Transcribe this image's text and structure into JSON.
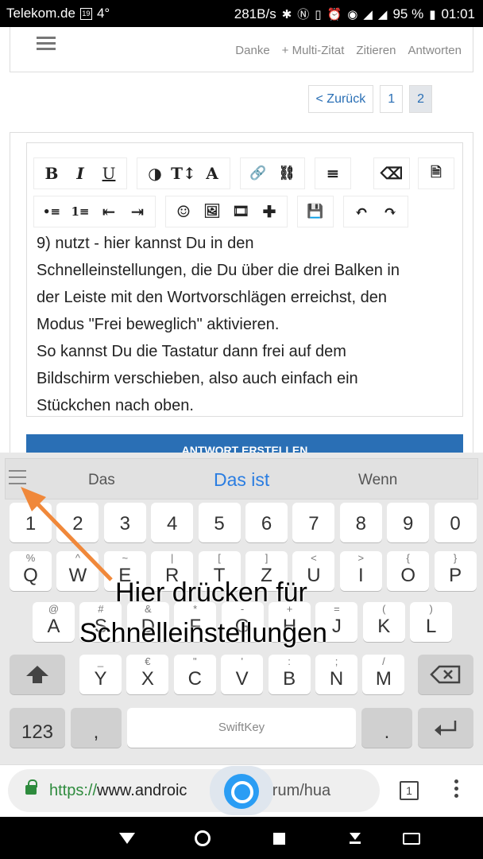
{
  "status": {
    "carrier": "Telekom.de",
    "calendar_day": "19",
    "temp": "4°",
    "speed": "281B/s",
    "battery": "95 %",
    "time": "01:01"
  },
  "post_actions": [
    "Danke",
    "+ Multi-Zitat",
    "Zitieren",
    "Antworten"
  ],
  "pager": {
    "back": "< Zurück",
    "pages": [
      "1",
      "2"
    ],
    "active": "2"
  },
  "editor": {
    "toolbar_row1": [
      [
        "B",
        "I",
        "U"
      ],
      [
        "◑",
        "T↕",
        "A"
      ],
      [
        "🔗",
        "⛓"
      ],
      [
        "≡"
      ]
    ],
    "toolbar_row1_right": [
      "⌫",
      "🗎"
    ],
    "toolbar_row2": [
      [
        "•≡",
        "1≡",
        "⇤",
        "⇥"
      ],
      [
        "☺",
        "🖼",
        "🎞",
        "✚"
      ],
      [
        "💾"
      ],
      [
        "↶",
        "↷"
      ]
    ],
    "text_lines": [
      "9) nutzt - hier kannst Du in den",
      "Schnelleinstellungen, die Du über die drei Balken in",
      "der Leiste mit den Wortvorschlägen erreichst, den",
      "Modus \"Frei beweglich\" aktivieren.",
      "So kannst Du die Tastatur dann frei auf dem",
      "Bildschirm verschieben, also auch einfach ein",
      "Stückchen nach oben."
    ]
  },
  "submit_label": "ANTWORT ERSTELLEN",
  "keyboard": {
    "suggestions": [
      "Das",
      "Das ist",
      "Wenn"
    ],
    "num_row": [
      "1",
      "2",
      "3",
      "4",
      "5",
      "6",
      "7",
      "8",
      "9",
      "0"
    ],
    "row1": [
      [
        "%",
        "Q"
      ],
      [
        "^",
        "W"
      ],
      [
        "~",
        "E"
      ],
      [
        "|",
        "R"
      ],
      [
        "[",
        "T"
      ],
      [
        "]",
        "Z"
      ],
      [
        "<",
        "U"
      ],
      [
        ">",
        "I"
      ],
      [
        "{",
        "O"
      ],
      [
        "}",
        "P"
      ]
    ],
    "row2": [
      [
        "@",
        "A"
      ],
      [
        "#",
        "S"
      ],
      [
        "&",
        "D"
      ],
      [
        "*",
        "F"
      ],
      [
        "-",
        "G"
      ],
      [
        "+",
        "H"
      ],
      [
        "=",
        "J"
      ],
      [
        "(",
        "K"
      ],
      [
        ")",
        "L"
      ]
    ],
    "row3": [
      [
        "_",
        "Y"
      ],
      [
        "€",
        "X"
      ],
      [
        "\"",
        "C"
      ],
      [
        "'",
        "V"
      ],
      [
        ":",
        "B"
      ],
      [
        ";",
        "N"
      ],
      [
        "/",
        "M"
      ]
    ],
    "key_123": "123",
    "key_comma": ",",
    "key_period": ".",
    "key_period_sub": ",!?",
    "space_brand": "SwiftKey"
  },
  "annotation": {
    "line1": "Hier drücken für",
    "line2": "Schnelleinstellungen"
  },
  "url": {
    "scheme": "https://",
    "host": "www.androic",
    "path": "e/forum/hua"
  },
  "tabs_count": "1"
}
